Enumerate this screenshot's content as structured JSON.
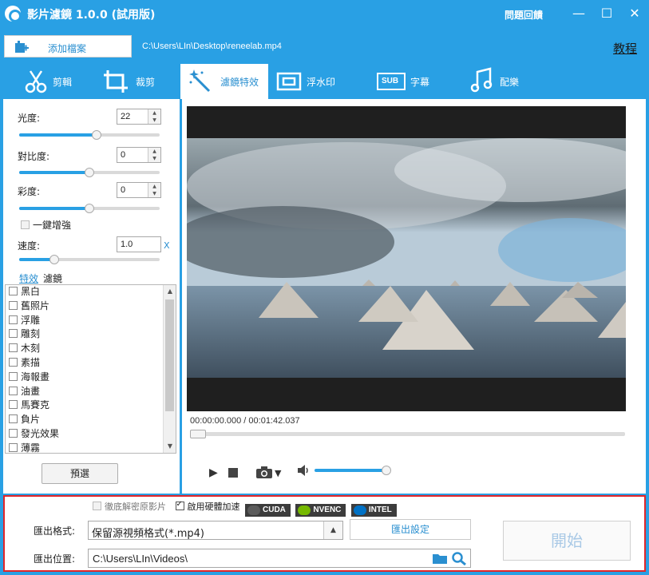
{
  "window": {
    "title": "影片濾鏡 1.0.0 (試用版)",
    "help_label": "問題回饋",
    "minimize": "—",
    "maximize": "☐",
    "close": "✕"
  },
  "toolbar": {
    "add_file_label": "添加檔案",
    "file_path": "C:\\Users\\LIn\\Desktop\\reneelab.mp4",
    "tutorial_label": "教程"
  },
  "tabs": [
    {
      "label": "剪輯",
      "icon": "scissors-icon",
      "active": false
    },
    {
      "label": "裁剪",
      "icon": "crop-icon",
      "active": false
    },
    {
      "label": "濾鏡特效",
      "icon": "magic-wand-icon",
      "active": true
    },
    {
      "label": "浮水印",
      "icon": "watermark-icon",
      "active": false
    },
    {
      "label": "字幕",
      "icon": "subtitle-icon",
      "badge": "SUB",
      "active": false
    },
    {
      "label": "配樂",
      "icon": "music-icon",
      "active": false
    }
  ],
  "adjust": {
    "brightness": {
      "label": "光度:",
      "value": "22",
      "level": 0.55
    },
    "contrast": {
      "label": "對比度:",
      "value": "0",
      "level": 0.5
    },
    "saturation": {
      "label": "彩度:",
      "value": "0",
      "level": 0.5
    },
    "auto_enhance": {
      "label": "一鍵增強",
      "checked": false
    },
    "speed": {
      "label": "速度:",
      "value": "1.0",
      "unit": "X",
      "level": 0.25
    }
  },
  "effects": {
    "tab_effects": "特效",
    "tab_filters": "濾鏡",
    "items": [
      "黑白",
      "舊照片",
      "浮雕",
      "雕刻",
      "木刻",
      "素描",
      "海報畫",
      "油畫",
      "馬賽克",
      "負片",
      "發光效果",
      "薄霧"
    ],
    "preset_label": "預選"
  },
  "player": {
    "current_time": "00:00:00.000",
    "separator": " / ",
    "total_time": "00:01:42.037",
    "progress": 0.0,
    "volume": 0.9
  },
  "export": {
    "source_cb_label": "徹底解密原影片",
    "hw_accel_label": "啟用硬體加速",
    "hw_accel_checked": true,
    "gpu_badges": [
      "CUDA",
      "NVENC",
      "INTEL"
    ],
    "format_label": "匯出格式:",
    "format_value": "保留源視頻格式(*.mp4)",
    "settings_label": "匯出設定",
    "location_label": "匯出位置:",
    "location_value": "C:\\Users\\LIn\\Videos\\",
    "start_label": "開始"
  },
  "colors": {
    "accent": "#29a0e4",
    "highlight_border": "#e0262a"
  }
}
